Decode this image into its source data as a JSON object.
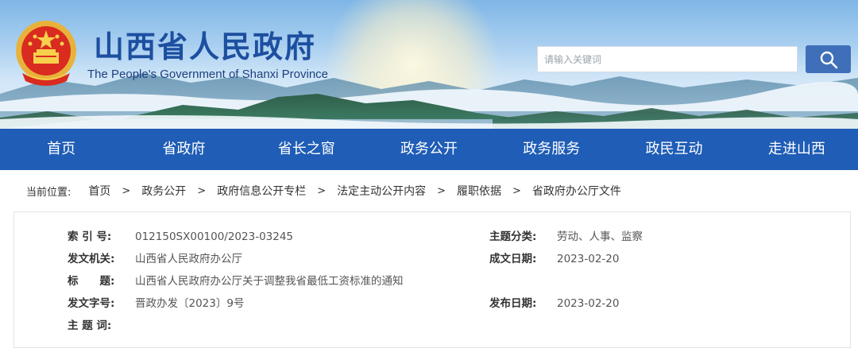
{
  "header": {
    "title": "山西省人民政府",
    "subtitle": "The People's Government of Shanxi Province",
    "search_placeholder": "请输入关键词",
    "emblem_icon": "national-emblem-icon",
    "search_icon": "magnifier-icon"
  },
  "nav": {
    "items": [
      "首页",
      "省政府",
      "省长之窗",
      "政务公开",
      "政务服务",
      "政民互动",
      "走进山西"
    ]
  },
  "breadcrumb": {
    "prefix": "当前位置:",
    "items": [
      "首页",
      "政务公开",
      "政府信息公开专栏",
      "法定主动公开内容",
      "履职依据",
      "省政府办公厅文件"
    ],
    "separator": ">"
  },
  "document": {
    "index_label": "索 引 号:",
    "index_value": "012150SX00100/2023-03245",
    "topic_label": "主题分类:",
    "topic_value": "劳动、人事、监察",
    "issuer_label": "发文机关:",
    "issuer_value": "山西省人民政府办公厅",
    "created_label": "成文日期:",
    "created_value": "2023-02-20",
    "title_label": "标　　题:",
    "title_value": "山西省人民政府办公厅关于调整我省最低工资标准的通知",
    "docno_label": "发文字号:",
    "docno_value": "晋政办发〔2023〕9号",
    "published_label": "发布日期:",
    "published_value": "2023-02-20",
    "keywords_label": "主 题 词:",
    "keywords_value": ""
  },
  "colors": {
    "nav_bg": "#1f5db6",
    "title_blue": "#1d4fa0",
    "search_button": "#3f6fb8"
  }
}
